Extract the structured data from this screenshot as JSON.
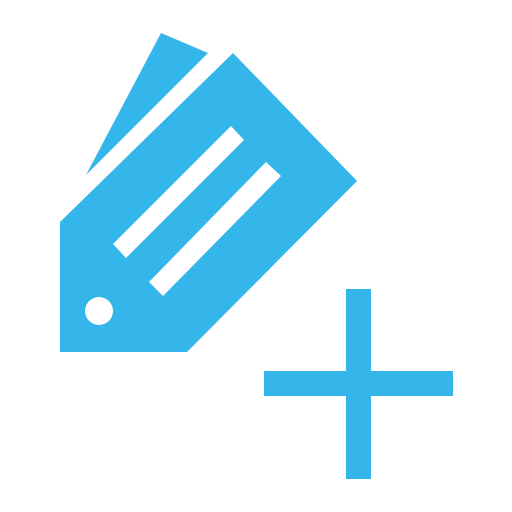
{
  "icon": {
    "name": "add-tag-icon",
    "parts": [
      "tag-back-icon",
      "tag-front-icon",
      "tag-hole-icon",
      "tag-line-icon",
      "plus-icon"
    ],
    "colors": {
      "accent": "#35b6ea",
      "background": "#ffffff",
      "cutout": "#ffffff"
    }
  }
}
